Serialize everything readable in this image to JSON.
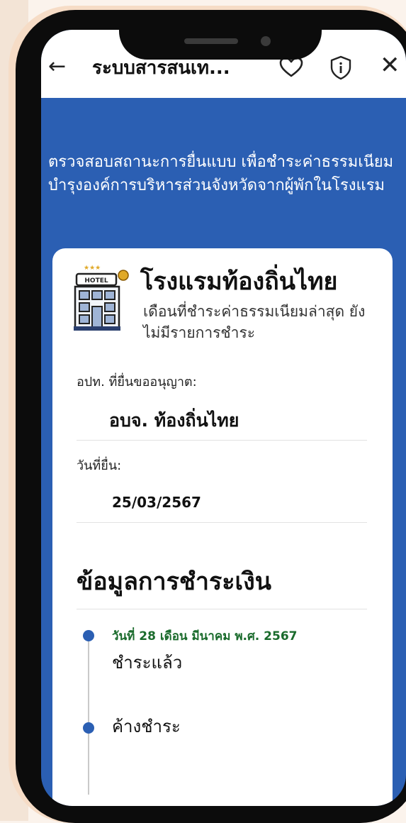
{
  "header": {
    "back_icon": "arrow-left-icon",
    "title": "ระบบสารสนเท...",
    "heart_icon": "heart-icon",
    "shield_icon": "shield-info-icon",
    "close_icon": "close-icon"
  },
  "intro": {
    "text": "ตรวจสอบสถานะการยื่นแบบ เพื่อชำระค่าธรรมเนียมบำรุงองค์การบริหารส่วนจังหวัดจากผู้พักในโรงแรม"
  },
  "hotel": {
    "name": "โรงแรมท้องถิ่นไทย",
    "subtitle": "เดือนที่ชำระค่าธรรมเนียมล่าสุด ยังไม่มีรายการชำระ",
    "logo_label": "HOTEL"
  },
  "details": {
    "authority_label": "อปท. ที่ยื่นขออนุญาต:",
    "authority_value": "อบจ. ท้องถิ่นไทย",
    "date_label": "วันที่ยื่น:",
    "date_value": "25/03/2567"
  },
  "payment": {
    "section_title": "ข้อมูลการชำระเงิน",
    "timeline": [
      {
        "date": "วันที่ 28 เดือน มีนาคม พ.ศ. 2567",
        "status": "ชำระแล้ว"
      },
      {
        "date": "",
        "status": "ค้างชำระ"
      }
    ]
  },
  "colors": {
    "primary_blue": "#2b5fb3",
    "date_green": "#1a6b2c",
    "phone_frame": "#0c0c0c"
  }
}
